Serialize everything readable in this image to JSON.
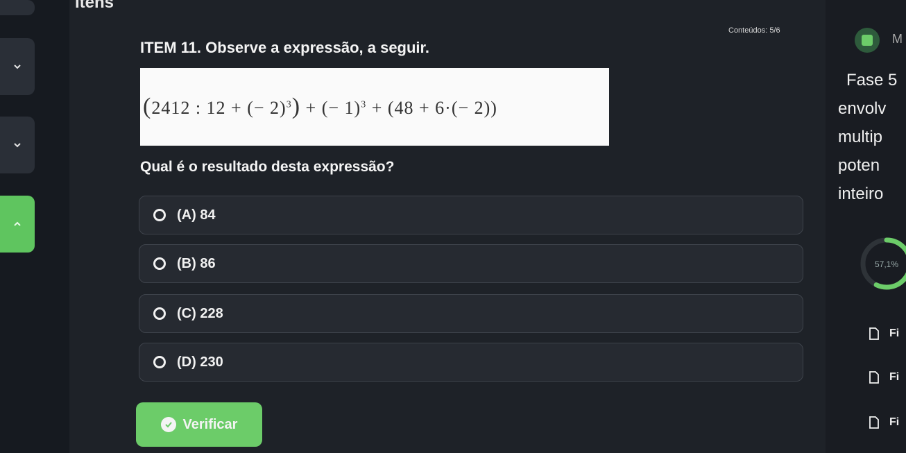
{
  "header": {
    "items_heading": "Itens",
    "content_count": "Conteúdos: 5/6"
  },
  "question": {
    "title": "ITEM 11. Observe a expressão, a seguir.",
    "expression": {
      "p1": "(",
      "p2": "2412 : 12 + (− 2)",
      "p3": "3",
      "p4": ")",
      "p5": " + (− 1)",
      "p6": "3",
      "p7": " + (48 + 6·(− 2))"
    },
    "prompt": "Qual é o resultado desta expressão?",
    "options": [
      {
        "label": "(A) 84"
      },
      {
        "label": "(B) 86"
      },
      {
        "label": "(C) 228"
      },
      {
        "label": "(D) 230"
      }
    ],
    "verify_label": "Verificar"
  },
  "right_panel": {
    "letter": "M",
    "phase_lines": [
      "Fase 5",
      "envolv",
      "multip",
      "poten",
      "inteiro"
    ],
    "progress_text": "57,1%",
    "progress_fraction": 0.571,
    "files": [
      {
        "label": "Fi",
        "icon": "file-icon"
      },
      {
        "label": "Fi",
        "icon": "file-icon"
      },
      {
        "label": "Fi",
        "icon": "file-icon"
      }
    ]
  },
  "colors": {
    "accent_green": "#6ccc69",
    "background": "#1e2228"
  }
}
